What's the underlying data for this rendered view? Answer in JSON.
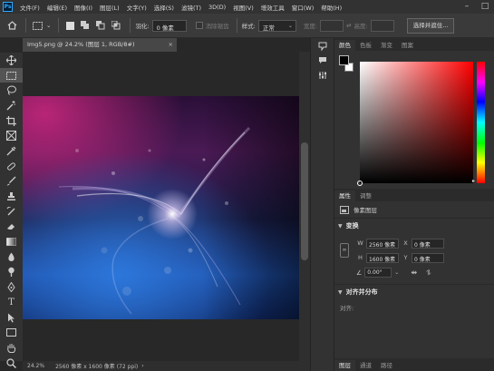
{
  "menubar": {
    "logo": "Ps",
    "items": [
      "文件(F)",
      "编辑(E)",
      "图像(I)",
      "图层(L)",
      "文字(Y)",
      "选择(S)",
      "滤镜(T)",
      "3D(D)",
      "视图(V)",
      "增效工具",
      "窗口(W)",
      "帮助(H)"
    ]
  },
  "options": {
    "feather_label": "羽化:",
    "feather_value": "0 像素",
    "antialias_label": "消除锯齿",
    "style_label": "样式:",
    "style_value": "正常",
    "width_label": "宽度:",
    "height_label": "高度:",
    "select_subject": "选择并遮住..."
  },
  "document": {
    "tab_title": "Img5.png @ 24.2% (图层 1, RGB/8#)",
    "close": "×"
  },
  "status": {
    "zoom": "24.2%",
    "dims": "2560 像素 x 1600 像素 (72 ppi)",
    "arrow": "›"
  },
  "color_panel": {
    "tabs": [
      "颜色",
      "色板",
      "渐变",
      "图案"
    ],
    "foreground": "#000000",
    "background": "#ffffff"
  },
  "properties": {
    "tabs": [
      "属性",
      "调整"
    ],
    "layer_type": "像素图层",
    "transform_title": "变换",
    "w_label": "W",
    "w_value": "2560 像素",
    "x_label": "X",
    "x_value": "0 像素",
    "h_label": "H",
    "h_value": "1600 像素",
    "y_label": "Y",
    "y_value": "0 像素",
    "angle_value": "0.00°",
    "align_title": "对齐并分布",
    "align_label": "对齐:"
  },
  "bottom_tabs": [
    "图层",
    "通道",
    "路径"
  ],
  "icons": {
    "home": "home-icon",
    "move": "move-tool-icon",
    "marquee": "rect-marquee-icon",
    "lasso": "lasso-icon",
    "wand": "magic-wand-icon",
    "crop": "crop-icon",
    "frame": "frame-icon",
    "eyedropper": "eyedropper-icon",
    "healing": "healing-brush-icon",
    "brush": "brush-icon",
    "stamp": "clone-stamp-icon",
    "history": "history-brush-icon",
    "eraser": "eraser-icon",
    "gradient": "gradient-icon",
    "blur": "blur-icon",
    "dodge": "dodge-icon",
    "pen": "pen-icon",
    "type": "type-icon",
    "path_select": "path-select-icon",
    "shape": "rectangle-shape-icon",
    "hand": "hand-icon",
    "zoom": "zoom-icon"
  }
}
